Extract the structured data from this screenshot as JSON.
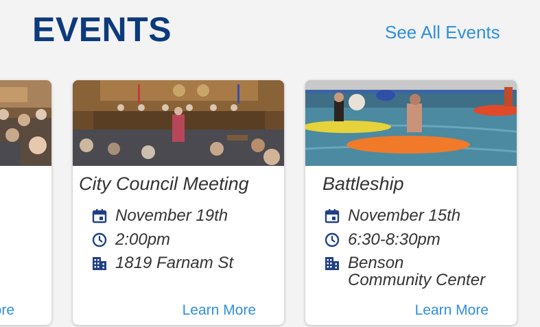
{
  "header": {
    "title": "EVENTS",
    "see_all_label": "See All Events"
  },
  "partial_card": {
    "learn_more_fragment": "lore"
  },
  "events": [
    {
      "title": "City Council Meeting",
      "date": "November 19th",
      "time": "2:00pm",
      "location": "1819 Farnam St",
      "learn_more": "Learn More"
    },
    {
      "title": "Battleship",
      "date": "November 15th",
      "time": "6:30-8:30pm",
      "location_line1": "Benson",
      "location_line2": "Community Center",
      "learn_more": "Learn More"
    }
  ],
  "colors": {
    "title": "#0d3a7c",
    "link": "#2f8fe0",
    "icon": "#1f3f86",
    "background": "#f3f3f3"
  },
  "icons": [
    "calendar-icon",
    "clock-icon",
    "building-icon"
  ]
}
